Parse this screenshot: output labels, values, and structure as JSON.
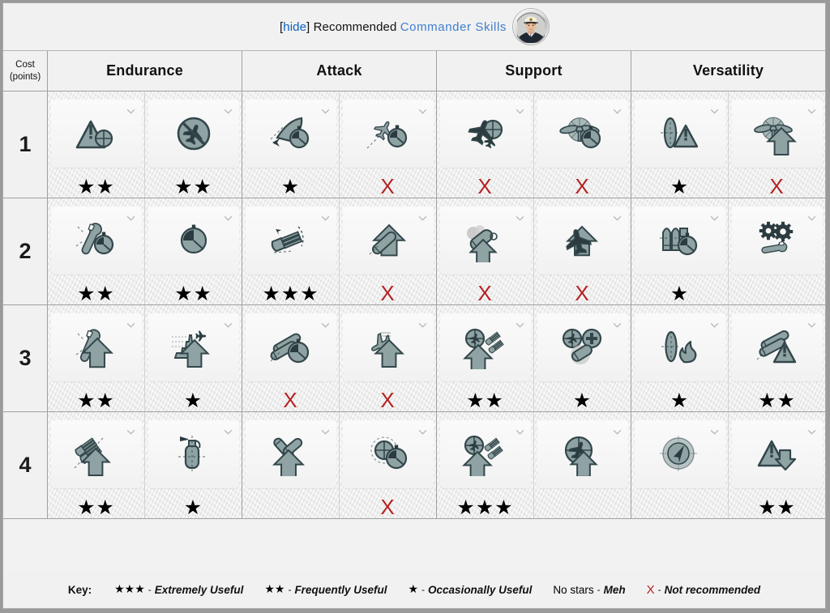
{
  "header": {
    "hide_label": "hide",
    "bracket_open": "[",
    "bracket_close": "]",
    "title_prefix": "Recommended",
    "title_link": "Commander Skills",
    "avatar_name": "commander-avatar"
  },
  "columns": {
    "cost_label_line1": "Cost",
    "cost_label_line2": "(points)",
    "headers": [
      "Endurance",
      "Attack",
      "Support",
      "Versatility"
    ]
  },
  "key": {
    "label": "Key:",
    "items": [
      {
        "mark": "★★★",
        "dash": "-",
        "desc": "Extremely Useful",
        "type": "stars"
      },
      {
        "mark": "★★",
        "dash": "-",
        "desc": "Frequently Useful",
        "type": "stars"
      },
      {
        "mark": "★",
        "dash": "-",
        "desc": "Occasionally Useful",
        "type": "stars"
      },
      {
        "mark": "No stars",
        "dash": "-",
        "desc": "Meh",
        "type": "nostars"
      },
      {
        "mark": "X",
        "dash": "-",
        "desc": "Not recommended",
        "type": "x"
      }
    ]
  },
  "colors": {
    "link": "#3f7fd0",
    "hide_link": "#0b5fc0",
    "x_red": "#b32020",
    "icon_fill": "#8fa3a4",
    "icon_stroke": "#33474b",
    "page_bg": "#f1f1f1",
    "grid_line": "#9fa0a0"
  },
  "rows": [
    {
      "cost": "1",
      "groups": [
        {
          "name": "Endurance",
          "skills": [
            {
              "icon": "warning-triangle-target",
              "rating": "★★",
              "rating_type": "stars"
            },
            {
              "icon": "no-plane-circle",
              "rating": "★★",
              "rating_type": "stars"
            }
          ]
        },
        {
          "name": "Attack",
          "skills": [
            {
              "icon": "ship-speed-stopwatch",
              "rating": "★",
              "rating_type": "stars"
            },
            {
              "icon": "plane-stopwatch",
              "rating": "X",
              "rating_type": "x"
            }
          ]
        },
        {
          "name": "Support",
          "skills": [
            {
              "icon": "plane-crosshair",
              "rating": "X",
              "rating_type": "x"
            },
            {
              "icon": "propeller-stopwatch",
              "rating": "X",
              "rating_type": "x"
            }
          ]
        },
        {
          "name": "Versatility",
          "skills": [
            {
              "icon": "torpedo-warning",
              "rating": "★",
              "rating_type": "stars"
            },
            {
              "icon": "propeller-up-arrow",
              "rating": "X",
              "rating_type": "x"
            }
          ]
        }
      ]
    },
    {
      "cost": "2",
      "groups": [
        {
          "name": "Endurance",
          "skills": [
            {
              "icon": "wrench-stopwatch",
              "rating": "★★",
              "rating_type": "stars"
            },
            {
              "icon": "stopwatch",
              "rating": "★★",
              "rating_type": "stars"
            }
          ]
        },
        {
          "name": "Attack",
          "skills": [
            {
              "icon": "turret-rotation",
              "rating": "★★★",
              "rating_type": "stars"
            },
            {
              "icon": "torpedo-up-arrow",
              "rating": "X",
              "rating_type": "x"
            }
          ]
        },
        {
          "name": "Support",
          "skills": [
            {
              "icon": "smoke-generator-up",
              "rating": "X",
              "rating_type": "x"
            },
            {
              "icon": "plane-up-arrow",
              "rating": "X",
              "rating_type": "x"
            }
          ]
        },
        {
          "name": "Versatility",
          "skills": [
            {
              "icon": "shells-stopwatch",
              "rating": "★",
              "rating_type": "stars"
            },
            {
              "icon": "gears-wrench",
              "rating": "",
              "rating_type": "none"
            }
          ]
        }
      ]
    },
    {
      "cost": "3",
      "groups": [
        {
          "name": "Endurance",
          "skills": [
            {
              "icon": "wrench-up-arrow",
              "rating": "★★",
              "rating_type": "stars"
            },
            {
              "icon": "carrier-plane-up",
              "rating": "★",
              "rating_type": "stars"
            }
          ]
        },
        {
          "name": "Attack",
          "skills": [
            {
              "icon": "torpedo-tubes-stopwatch",
              "rating": "X",
              "rating_type": "x"
            },
            {
              "icon": "plane-up-arrow-2",
              "rating": "X",
              "rating_type": "x"
            }
          ]
        },
        {
          "name": "Support",
          "skills": [
            {
              "icon": "aa-plane-up-arrow",
              "rating": "★★",
              "rating_type": "stars"
            },
            {
              "icon": "aa-plus-consumable",
              "rating": "★",
              "rating_type": "stars"
            }
          ]
        },
        {
          "name": "Versatility",
          "skills": [
            {
              "icon": "torpedo-fire",
              "rating": "★",
              "rating_type": "stars"
            },
            {
              "icon": "torpedo-tubes-warning",
              "rating": "★★",
              "rating_type": "stars"
            }
          ]
        }
      ]
    },
    {
      "cost": "4",
      "groups": [
        {
          "name": "Endurance",
          "skills": [
            {
              "icon": "turrets-up-arrow",
              "rating": "★★",
              "rating_type": "stars"
            },
            {
              "icon": "fire-extinguisher",
              "rating": "★",
              "rating_type": "stars"
            }
          ]
        },
        {
          "name": "Attack",
          "skills": [
            {
              "icon": "torpedo-cross-up-arrow",
              "rating": "",
              "rating_type": "none"
            },
            {
              "icon": "radar-stopwatch",
              "rating": "X",
              "rating_type": "x"
            }
          ]
        },
        {
          "name": "Support",
          "skills": [
            {
              "icon": "aa-plane-up-arrow-2",
              "rating": "★★★",
              "rating_type": "stars"
            },
            {
              "icon": "plane-target-up-arrow",
              "rating": "",
              "rating_type": "none"
            }
          ]
        },
        {
          "name": "Versatility",
          "skills": [
            {
              "icon": "radar-dome",
              "rating": "",
              "rating_type": "none"
            },
            {
              "icon": "warning-down-arrow",
              "rating": "★★",
              "rating_type": "stars"
            }
          ]
        }
      ]
    }
  ]
}
